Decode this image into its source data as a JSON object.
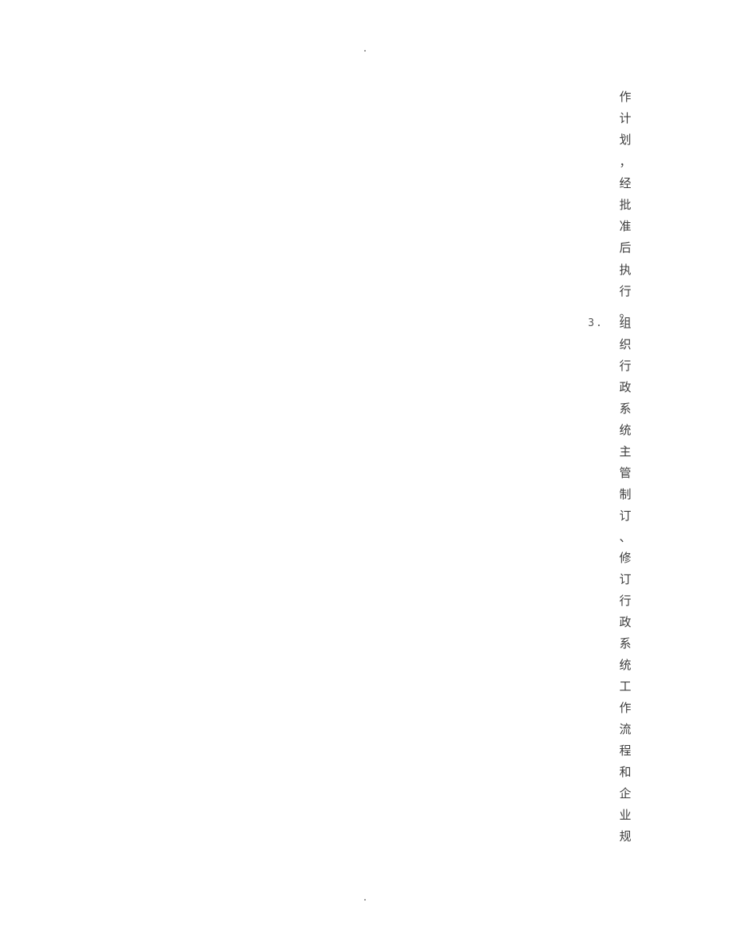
{
  "document": {
    "header_mark": "·",
    "footer_mark": "·",
    "continued_text": [
      "作",
      "计",
      "划",
      "，",
      "经",
      "批",
      "准",
      "后",
      "执",
      "行",
      "。"
    ],
    "item": {
      "marker": "3.",
      "text": [
        "组",
        "织",
        "行",
        "政",
        "系",
        "统",
        "主",
        "管",
        "制",
        "订",
        "、",
        "修",
        "订",
        "行",
        "政",
        "系",
        "统",
        "工",
        "作",
        "流",
        "程",
        "和",
        "企",
        "业",
        "规"
      ]
    }
  }
}
